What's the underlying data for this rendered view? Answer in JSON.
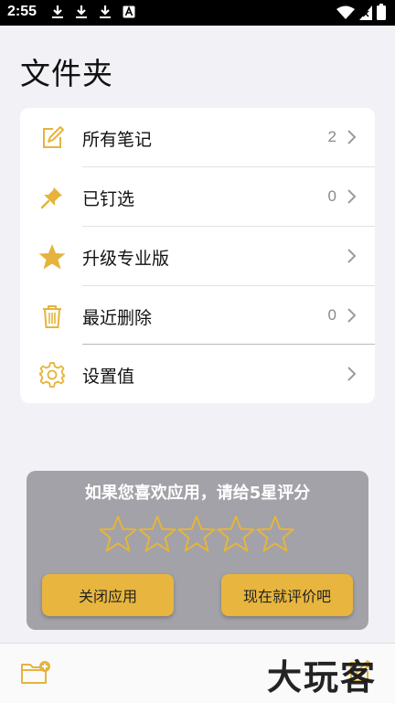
{
  "status_bar": {
    "time": "2:55",
    "icons": [
      "download-icon",
      "download-icon",
      "download-icon",
      "text-a-icon",
      "wifi-icon",
      "no-sim-icon",
      "battery-icon"
    ]
  },
  "page": {
    "title": "文件夹"
  },
  "folders": {
    "items": [
      {
        "label": "所有笔记",
        "count": "2",
        "icon": "edit-note-icon"
      },
      {
        "label": "已钉选",
        "count": "0",
        "icon": "pin-icon"
      },
      {
        "label": "升级专业版",
        "count": "",
        "icon": "star-icon"
      },
      {
        "label": "最近删除",
        "count": "0",
        "icon": "trash-icon"
      },
      {
        "label": "设置值",
        "count": "",
        "icon": "gear-icon"
      }
    ]
  },
  "rating": {
    "prompt": "如果您喜欢应用，请给5星评分",
    "star_count": 5,
    "close_label": "关闭应用",
    "rate_label": "现在就评价吧"
  },
  "bottom_bar": {
    "left_icon": "new-folder-icon",
    "right_icon": "compose-icon",
    "watermark": "大玩客"
  },
  "colors": {
    "accent": "#e6b43c",
    "background": "#f2f2f6",
    "card": "#ffffff",
    "rating_card": "#a2a2a8",
    "secondary_text": "#8a8a8e"
  }
}
